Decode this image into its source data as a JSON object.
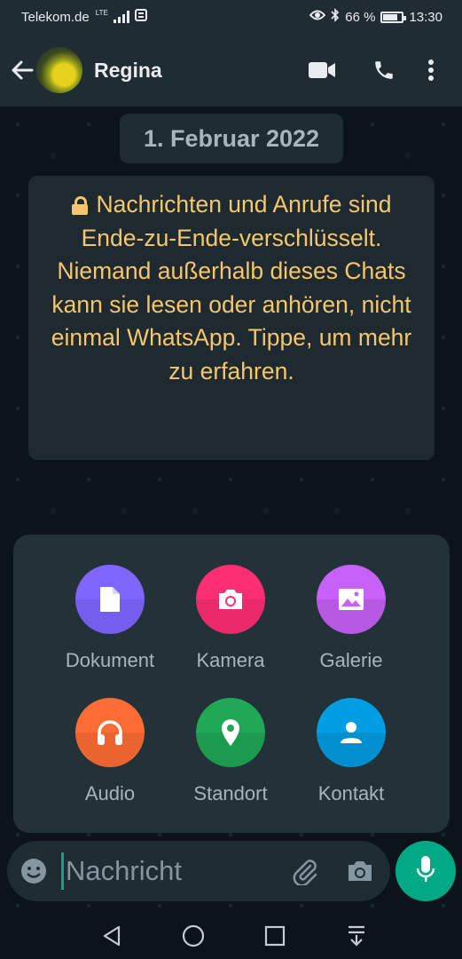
{
  "status_bar": {
    "carrier": "Telekom.de",
    "network": "LTE",
    "battery": "66 %",
    "time": "13:30"
  },
  "header": {
    "back_icon": "arrow-left-icon",
    "contact_name": "Regina",
    "actions": [
      "video-call-icon",
      "voice-call-icon",
      "more-vert-icon"
    ]
  },
  "chat": {
    "date_chip": "1. Februar 2022",
    "e2e_notice": "Nachrichten und Anrufe sind Ende-zu-Ende-verschlüsselt. Niemand außerhalb dieses Chats kann sie lesen oder anhören, nicht einmal WhatsApp. Tippe, um mehr zu erfahren."
  },
  "attach_menu": {
    "items": [
      {
        "label": "Dokument",
        "icon": "document-icon",
        "color": "#7f66ff"
      },
      {
        "label": "Kamera",
        "icon": "camera-icon",
        "color": "#fe2e74"
      },
      {
        "label": "Galerie",
        "icon": "gallery-icon",
        "color": "#c861fa"
      },
      {
        "label": "Audio",
        "icon": "headphones-icon",
        "color": "#ff6d34"
      },
      {
        "label": "Standort",
        "icon": "location-icon",
        "color": "#1fa855"
      },
      {
        "label": "Kontakt",
        "icon": "contact-icon",
        "color": "#009de2"
      }
    ]
  },
  "input": {
    "placeholder": "Nachricht",
    "accent": "#00a884"
  },
  "nav": [
    "back-triangle-icon",
    "home-circle-icon",
    "recents-square-icon",
    "notification-pull-icon"
  ]
}
